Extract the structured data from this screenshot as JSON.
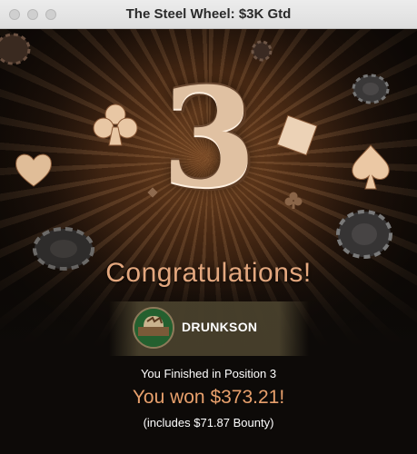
{
  "window": {
    "title": "The Steel Wheel: $3K Gtd",
    "buttons": [
      "close",
      "minimize",
      "zoom"
    ]
  },
  "result": {
    "position_number": "3",
    "headline": "Congratulations!",
    "player_name": "DRUNKSON",
    "finished_text": "You Finished in Position 3",
    "won_text": "You won $373.21!",
    "bounty_text": "(includes $71.87 Bounty)"
  },
  "decorations": [
    "club-icon",
    "heart-icon",
    "diamond-icon",
    "spade-icon",
    "poker-chip-icon"
  ],
  "colors": {
    "accent": "#e8a06c",
    "background": "#1a1410",
    "number_metal": "#e0c1a2"
  }
}
